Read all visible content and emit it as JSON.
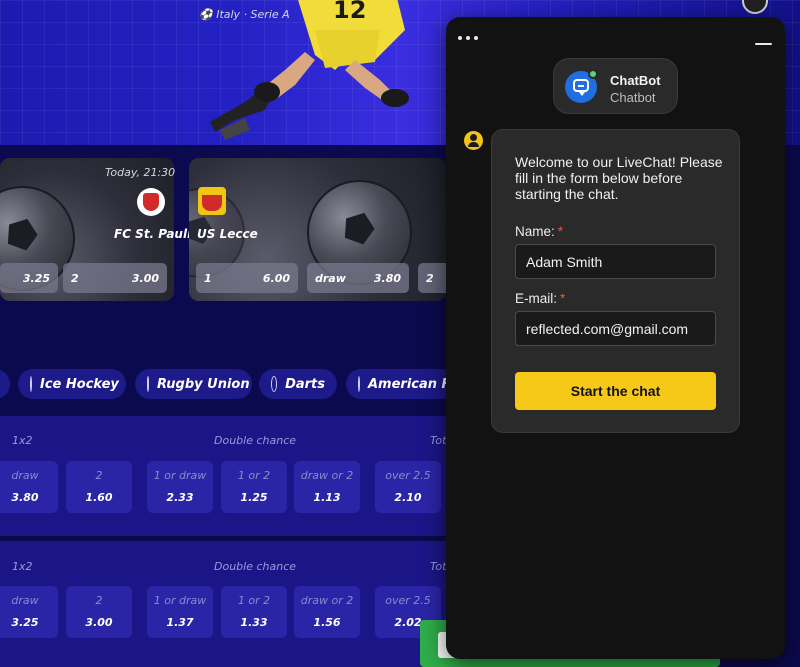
{
  "hero": {
    "player_number": "12"
  },
  "matches": [
    {
      "time": "Today, 21:30",
      "team": "FC St. Pauli",
      "odds": [
        {
          "label": "",
          "value": "3.25"
        },
        {
          "label": "2",
          "value": "3.00"
        }
      ]
    },
    {
      "league": "Italy · Serie A",
      "team": "US Lecce",
      "odds": [
        {
          "label": "1",
          "value": "6.00"
        },
        {
          "label": "draw",
          "value": "3.80"
        },
        {
          "label": "2",
          "value": ""
        }
      ]
    }
  ],
  "sports": [
    {
      "label": "Ice Hockey",
      "icon": "hockey-icon"
    },
    {
      "label": "Rugby Union",
      "icon": "rugby-icon"
    },
    {
      "label": "Darts",
      "icon": "darts-icon"
    },
    {
      "label": "American F",
      "icon": "american-football-icon"
    }
  ],
  "markets": [
    {
      "headers": {
        "h1": "1x2",
        "h2": "Double chance",
        "h3": "Tot"
      },
      "odds": [
        {
          "label": "draw",
          "value": "3.80"
        },
        {
          "label": "2",
          "value": "1.60"
        },
        {
          "label": "1 or draw",
          "value": "2.33"
        },
        {
          "label": "1 or 2",
          "value": "1.25"
        },
        {
          "label": "draw or 2",
          "value": "1.13"
        },
        {
          "label": "over 2.5",
          "value": "2.10"
        }
      ]
    },
    {
      "headers": {
        "h1": "1x2",
        "h2": "Double chance",
        "h3": "Tot"
      },
      "odds": [
        {
          "label": "draw",
          "value": "3.25"
        },
        {
          "label": "2",
          "value": "3.00"
        },
        {
          "label": "1 or draw",
          "value": "1.37"
        },
        {
          "label": "1 or 2",
          "value": "1.33"
        },
        {
          "label": "draw or 2",
          "value": "1.56"
        },
        {
          "label": "over 2.5",
          "value": "2.02"
        }
      ]
    }
  ],
  "chat": {
    "agent_name": "ChatBot",
    "agent_role": "Chatbot",
    "welcome": "Welcome to our LiveChat! Please fill in the form below before starting the chat.",
    "name_label": "Name:",
    "name_value": "Adam Smith",
    "email_label": "E-mail:",
    "email_value": "reflected.com@gmail.com",
    "required_mark": "*",
    "start_button": "Start the chat"
  },
  "colors": {
    "accent": "#f6c818",
    "chat_bg": "#121212",
    "card_bg": "#2a2a2a",
    "site_bg": "#0b0a4e",
    "status_online": "#5ed17a",
    "required": "#e2564d"
  }
}
